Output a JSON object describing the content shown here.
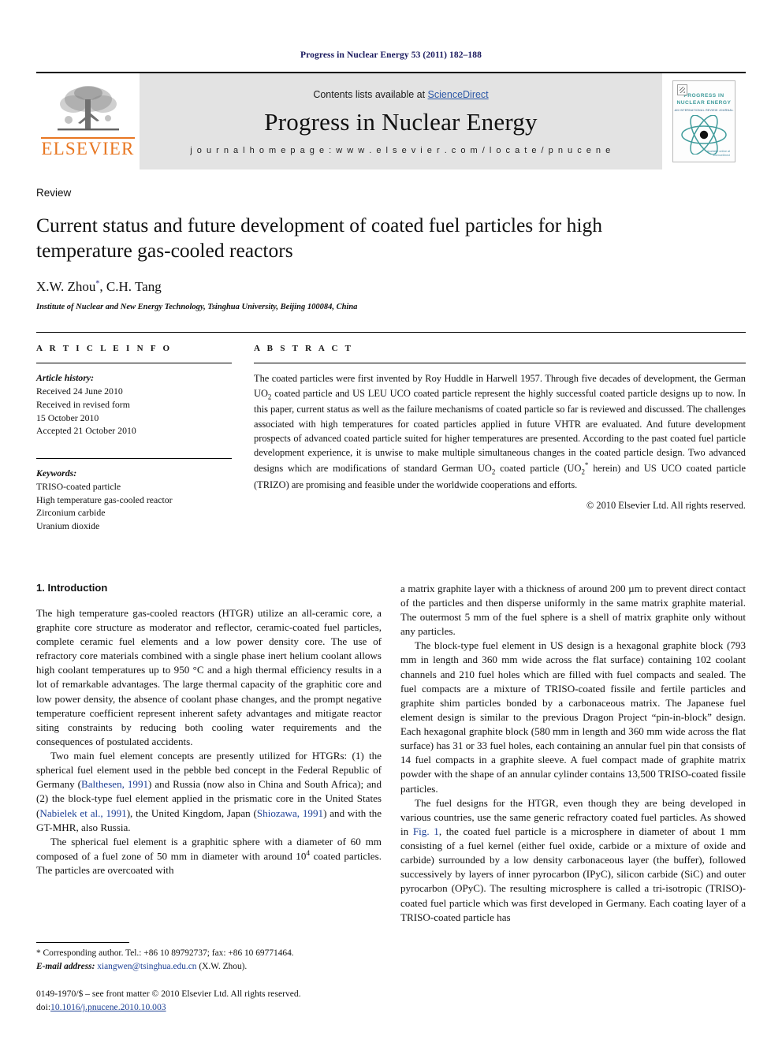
{
  "running_head": "Progress in Nuclear Energy 53 (2011) 182–188",
  "banner": {
    "contents_prefix": "Contents lists available at ",
    "sciencedirect": "ScienceDirect",
    "journal_title": "Progress in Nuclear Energy",
    "homepage": "j o u r n a l   h o m e p a g e :   w w w . e l s e v i e r . c o m / l o c a t e / p n u c e n e",
    "publisher_wordmark": "ELSEVIER",
    "cover": {
      "title_line1": "PROGRESS IN",
      "title_line2": "NUCLEAR ENERGY",
      "subtitle": "AN INTERNATIONAL REVIEW JOURNAL",
      "footer_line1": "Available online at",
      "footer_line2": "ScienceDirect"
    },
    "accent_color": "#2b57a6",
    "elsevier_orange": "#E87722",
    "cover_teal": "#3f9b9b"
  },
  "article": {
    "doctype": "Review",
    "title": "Current status and future development of coated fuel particles for high temperature gas-cooled reactors",
    "authors": "X.W. Zhou",
    "authors_star": "*",
    "authors_rest": ", C.H. Tang",
    "affiliation": "Institute of Nuclear and New Energy Technology, Tsinghua University, Beijing 100084, China"
  },
  "article_info": {
    "heading": "A R T I C L E   I N F O",
    "history_label": "Article history:",
    "history": [
      "Received 24 June 2010",
      "Received in revised form",
      "15 October 2010",
      "Accepted 21 October 2010"
    ],
    "keywords_label": "Keywords:",
    "keywords": [
      "TRISO-coated particle",
      "High temperature gas-cooled reactor",
      "Zirconium carbide",
      "Uranium dioxide"
    ]
  },
  "abstract": {
    "heading": "A B S T R A C T",
    "part1": "The coated particles were first invented by Roy Huddle in Harwell 1957. Through five decades of development, the German UO",
    "sub1": "2",
    "part2": " coated particle and US LEU UCO coated particle represent the highly successful coated particle designs up to now. In this paper, current status as well as the failure mechanisms of coated particle so far is reviewed and discussed. The challenges associated with high temperatures for coated particles applied in future VHTR are evaluated. And future development prospects of advanced coated particle suited for higher temperatures are presented. According to the past coated fuel particle development experience, it is unwise to make multiple simultaneous changes in the coated particle design. Two advanced designs which are modifications of standard German UO",
    "sub2": "2",
    "part3": " coated particle (UO",
    "sub3": "2",
    "sup3": "*",
    "part4": " herein) and US UCO coated particle (TRIZO) are promising and feasible under the worldwide cooperations and efforts.",
    "copyright": "© 2010 Elsevier Ltd. All rights reserved."
  },
  "section": {
    "number_title": "1. Introduction"
  },
  "left_column": {
    "p1": "The high temperature gas-cooled reactors (HTGR) utilize an all-ceramic core, a graphite core structure as moderator and reflector, ceramic-coated fuel particles, complete ceramic fuel elements and a low power density core. The use of refractory core materials combined with a single phase inert helium coolant allows high coolant temperatures up to 950 °C and a high thermal efficiency results in a lot of remarkable advantages. The large thermal capacity of the graphitic core and low power density, the absence of coolant phase changes, and the prompt negative temperature coefficient represent inherent safety advantages and mitigate reactor siting constraints by reducing both cooling water requirements and the consequences of postulated accidents.",
    "p2_a": "Two main fuel element concepts are presently utilized for HTGRs: (1) the spherical fuel element used in the pebble bed concept in the Federal Republic of Germany (",
    "p2_ref1": "Balthesen, 1991",
    "p2_b": ") and Russia (now also in China and South Africa); and (2) the block-type fuel element applied in the prismatic core in the United States (",
    "p2_ref2": "Nabielek et al., 1991",
    "p2_c": "), the United Kingdom, Japan (",
    "p2_ref3": "Shiozawa, 1991",
    "p2_d": ") and with the GT-MHR, also Russia.",
    "p3_a": "The spherical fuel element is a graphitic sphere with a diameter of 60 mm composed of a fuel zone of 50 mm in diameter with around 10",
    "p3_sup": "4",
    "p3_b": " coated particles. The particles are overcoated with"
  },
  "right_column": {
    "p1": "a matrix graphite layer with a thickness of around 200 µm to prevent direct contact of the particles and then disperse uniformly in the same matrix graphite material. The outermost 5 mm of the fuel sphere is a shell of matrix graphite only without any particles.",
    "p2": "The block-type fuel element in US design is a hexagonal graphite block (793 mm in length and 360 mm wide across the flat surface) containing 102 coolant channels and 210 fuel holes which are filled with fuel compacts and sealed. The fuel compacts are a mixture of TRISO-coated fissile and fertile particles and graphite shim particles bonded by a carbonaceous matrix. The Japanese fuel element design is similar to the previous Dragon Project “pin-in-block” design. Each hexagonal graphite block (580 mm in length and 360 mm wide across the flat surface) has 31 or 33 fuel holes, each containing an annular fuel pin that consists of 14 fuel compacts in a graphite sleeve. A fuel compact made of graphite matrix powder with the shape of an annular cylinder contains 13,500 TRISO-coated fissile particles.",
    "p3_a": "The fuel designs for the HTGR, even though they are being developed in various countries, use the same generic refractory coated fuel particles. As showed in ",
    "p3_ref": "Fig. 1",
    "p3_b": ", the coated fuel particle is a microsphere in diameter of about 1 mm consisting of a fuel kernel (either fuel oxide, carbide or a mixture of oxide and carbide) surrounded by a low density carbonaceous layer (the buffer), followed successively by layers of inner pyrocarbon (IPyC), silicon carbide (SiC) and outer pyrocarbon (OPyC). The resulting microsphere is called a tri-isotropic (TRISO)-coated fuel particle which was first developed in Germany. Each coating layer of a TRISO-coated particle has"
  },
  "footnotes": {
    "corresponding": "* Corresponding author. Tel.: +86 10 89792737; fax: +86 10 69771464.",
    "email_label": "E-mail address:",
    "email": "xiangwen@tsinghua.edu.cn",
    "email_suffix": " (X.W. Zhou).",
    "issn_line": "0149-1970/$ – see front matter © 2010 Elsevier Ltd. All rights reserved.",
    "doi_prefix": "doi:",
    "doi": "10.1016/j.pnucene.2010.10.003"
  }
}
